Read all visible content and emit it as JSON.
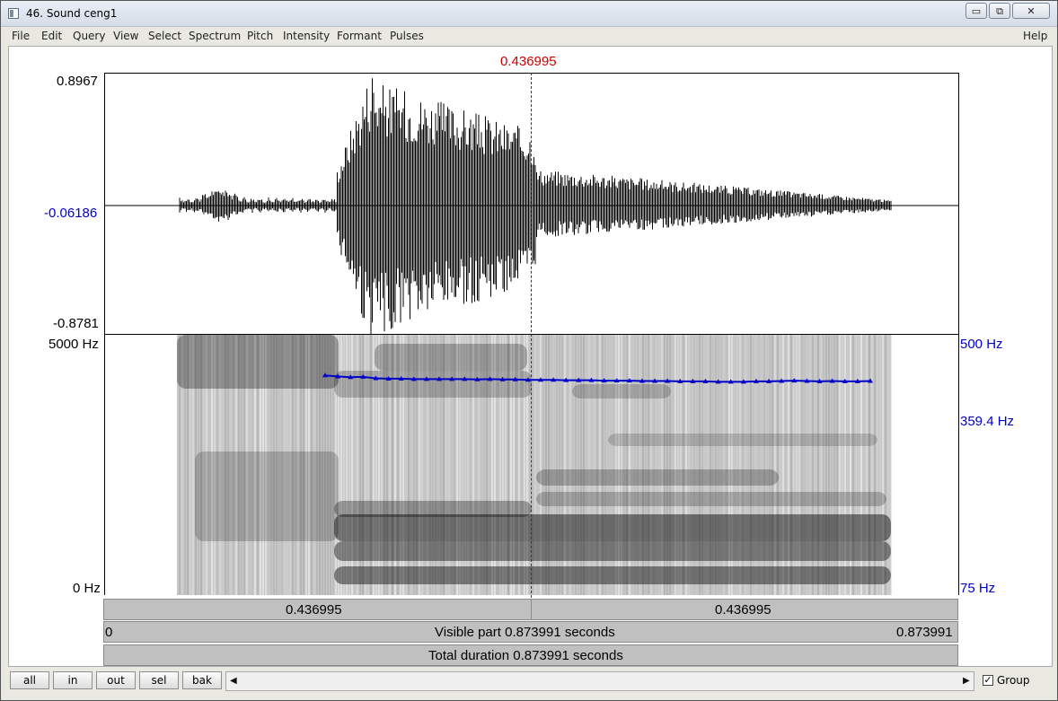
{
  "window": {
    "title": "46. Sound ceng1",
    "minimize": "▭",
    "maximize": "⧉",
    "close": "✕"
  },
  "menu": [
    "File",
    "Edit",
    "Query",
    "View",
    "Select",
    "Spectrum",
    "Pitch",
    "Intensity",
    "Formant",
    "Pulses",
    "Help"
  ],
  "cursor_time": "0.436995",
  "waveform": {
    "ymax": "0.8967",
    "ymid": "-0.06186",
    "ymin": "-0.8781"
  },
  "spectrogram": {
    "freq_max": "5000 Hz",
    "freq_min": "0 Hz",
    "pitch_max": "500 Hz",
    "pitch_value": "359.4 Hz",
    "pitch_min": "75 Hz"
  },
  "pitch_track_hz": [
    372,
    369,
    367,
    368,
    364,
    363,
    363,
    362,
    362,
    362,
    362,
    362,
    361,
    362,
    361,
    361,
    360,
    360,
    360,
    359,
    359,
    359,
    358,
    358,
    358,
    357,
    357,
    357,
    356,
    356,
    356,
    355,
    355,
    355,
    356,
    356,
    357,
    358,
    357,
    356,
    357,
    356,
    356,
    357
  ],
  "selection": {
    "left_duration": "0.436995",
    "right_duration": "0.436995"
  },
  "visible": {
    "start": "0",
    "label": "Visible part 0.873991 seconds",
    "end": "0.873991"
  },
  "total": {
    "label": "Total duration 0.873991 seconds"
  },
  "buttons": {
    "all": "all",
    "in": "in",
    "out": "out",
    "sel": "sel",
    "bak": "bak"
  },
  "scroll": {
    "left_arrow": "◀",
    "right_arrow": "▶"
  },
  "group": {
    "checked": "✓",
    "label": "Group"
  },
  "colors": {
    "cursor": "#d00000",
    "pitch": "#0000c8",
    "waveform": "#000000"
  },
  "icons": {
    "window": "app-window-icon"
  }
}
